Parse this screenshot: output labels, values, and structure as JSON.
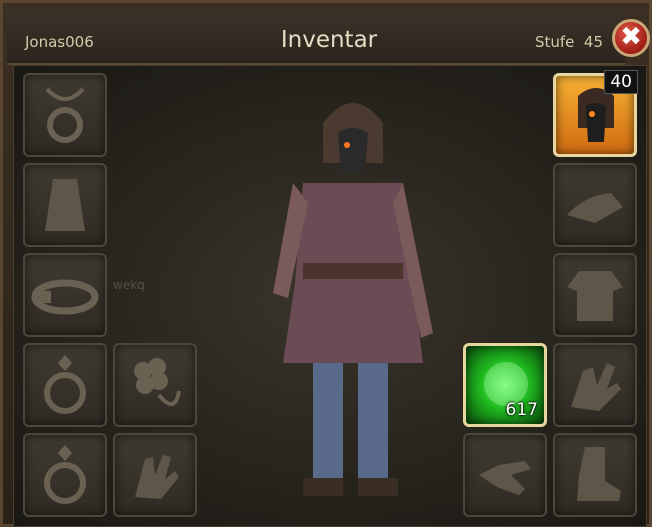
{
  "window": {
    "title": "Inventar",
    "player_name": "Jonas006",
    "level_label": "Stufe",
    "level_value": "45",
    "close_glyph": "✖"
  },
  "equipped": {
    "helmet": {
      "icon": "plague-mask-helmet-icon",
      "level": "40"
    },
    "consumable": {
      "icon": "green-orb-icon",
      "count": "617"
    }
  },
  "empty_slots_left": [
    "amulet-slot-icon",
    "cape-slot-icon",
    "belt-slot-icon",
    "ring-slot-icon",
    "clover-charm-slot-icon",
    "ring-slot-icon",
    "glove-slot-icon"
  ],
  "empty_slots_right": [
    "shoulder-armor-slot-icon",
    "shirt-slot-icon",
    "gauntlet-slot-icon",
    "glove-slot-icon",
    "boot-slot-icon"
  ],
  "watermark": "wekq",
  "colors": {
    "frame": "#5a4630",
    "title": "#e6dcc4",
    "close": "#b8281d",
    "helmet_bg": "#f0a020",
    "orb": "#2ee02e"
  }
}
